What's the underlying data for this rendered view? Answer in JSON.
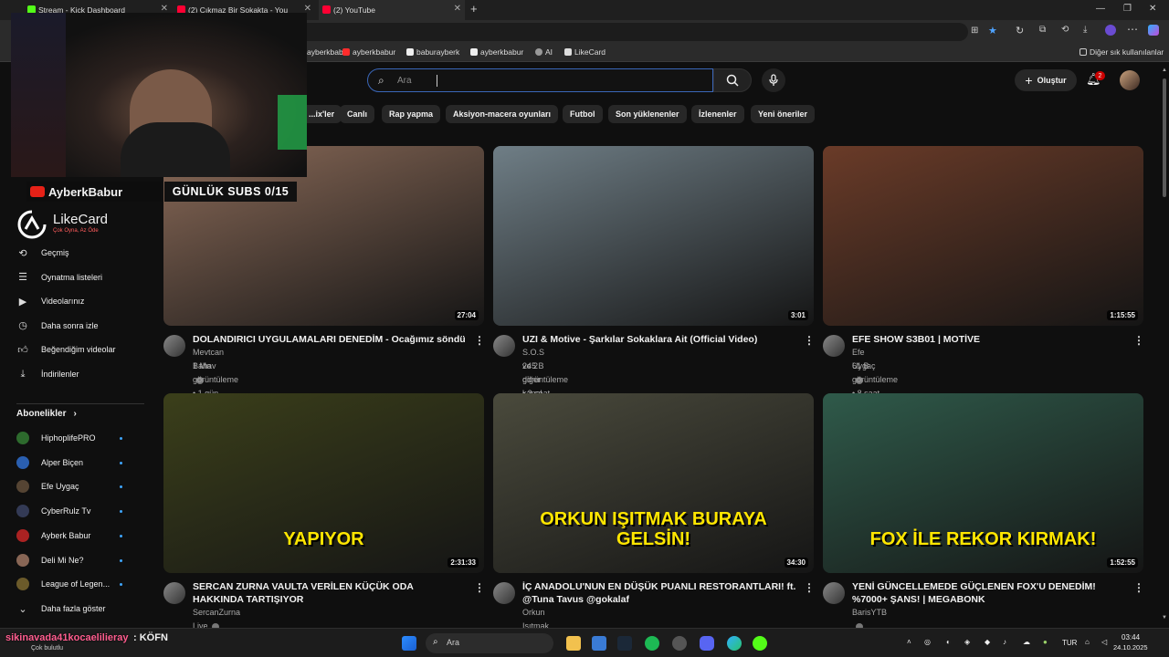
{
  "browser": {
    "tabs": [
      {
        "label": "Stream - Kick Dashboard"
      },
      {
        "label": "(2) Çıkmaz Bir Sokakta - You"
      },
      {
        "label": "(2) YouTube"
      }
    ],
    "bookmarks": [
      "ayberkbabur",
      "ayberkbabur",
      "baburayberk",
      "ayberkbabur",
      "AI",
      "LikeCard"
    ],
    "other_bookmarks": "Diğer sık kullanılanlar"
  },
  "header": {
    "search_placeholder": "Ara",
    "create_label": "Oluştur",
    "notifications_count": "2"
  },
  "chips": [
    "...ix'ler",
    "Canlı",
    "Rap yapma",
    "Aksiyon-macera oyunları",
    "Futbol",
    "Son yüklenenler",
    "İzlenenler",
    "Yeni öneriler"
  ],
  "sidebar": {
    "brand": {
      "name": "LikeCard",
      "tagline": "Çok Oyna, Az Öde"
    },
    "items": [
      {
        "label": "Geçmiş",
        "icon": "history-icon"
      },
      {
        "label": "Oynatma listeleri",
        "icon": "playlist-icon"
      },
      {
        "label": "Videolarınız",
        "icon": "video-icon"
      },
      {
        "label": "Daha sonra izle",
        "icon": "clock-icon"
      },
      {
        "label": "Beğendiğim videolar",
        "icon": "thumb-up-icon"
      },
      {
        "label": "İndirilenler",
        "icon": "download-icon"
      }
    ],
    "subscriptions_title": "Abonelikler",
    "subscriptions": [
      {
        "name": "HiphoplifePRO",
        "color": "#2d6a2d"
      },
      {
        "name": "Alper Biçen",
        "color": "#2a5fb0"
      },
      {
        "name": "Efe Uygaç",
        "color": "#554433"
      },
      {
        "name": "CyberRulz Tv",
        "color": "#333a55"
      },
      {
        "name": "Ayberk Babur",
        "color": "#aa2222"
      },
      {
        "name": "Deli Mi Ne?",
        "color": "#886655"
      },
      {
        "name": "League of Legen...",
        "color": "#6b5a2a"
      }
    ],
    "show_more": "Daha fazla göster"
  },
  "videos": [
    {
      "title": "DOLANDIRICI UYGULAMALARI DENEDİM - Ocağımız söndü",
      "channel": "Mevtcan Bahav",
      "meta": "1 Mn görüntüleme • 1 gün önce",
      "duration": "27:04",
      "thumb": "#8a6a58"
    },
    {
      "title": "UZI & Motive - Şarkılar Sokaklara Ait (Official Video)",
      "channel": "S.O.S ve 2 diğer kanal",
      "meta": "245 B görüntüleme • 3 saat önce",
      "duration": "3:01",
      "thumb": "#6f7e86"
    },
    {
      "title": "EFE SHOW S3B01 | MOTİVE",
      "channel": "Efe Uygaç",
      "meta": "61 B görüntüleme • 8 saat önce",
      "duration": "1:15:55",
      "thumb": "#6a3b28"
    },
    {
      "title": "SERCAN ZURNA VAULTA VERİLEN KÜÇÜK ODA HAKKINDA TARTIŞIYOR",
      "channel": "SercanZurna Live",
      "meta": "",
      "duration": "2:31:33",
      "thumb": "#3b3f1a",
      "thumb_text": "YAPIYOR"
    },
    {
      "title": "İÇ ANADOLU'NUN EN DÜŞÜK PUANLI RESTORANTLARI! ft. @Tuna Tavus  @gokalaf",
      "channel": "Orkun Işıtmak",
      "meta": "",
      "duration": "34:30",
      "thumb": "#4a4a3c",
      "thumb_text": "ORKUN IŞITMAK BURAYA GELSİN!"
    },
    {
      "title": "YENİ GÜNCELLEMEDE GÜÇLENEN FOX'U DENEDİM! %7000+ ŞANS! | MEGABONK",
      "channel": "BarisYTB",
      "meta": "",
      "duration": "1:52:55",
      "thumb": "#2f5a4a",
      "thumb_text": "FOX İLE REKOR KIRMAK!"
    }
  ],
  "stream_overlay": {
    "streamer": "AyberkBabur",
    "subs_goal": "GÜNLÜK SUBS 0/15",
    "chat_user": "sikinavada41kocaelilieray",
    "chat_message": ": KÖFN",
    "weather": "Çok bulutlu"
  },
  "taskbar": {
    "search": "Ara",
    "lang": "TUR",
    "time": "03:44",
    "date": "24.10.2025"
  }
}
